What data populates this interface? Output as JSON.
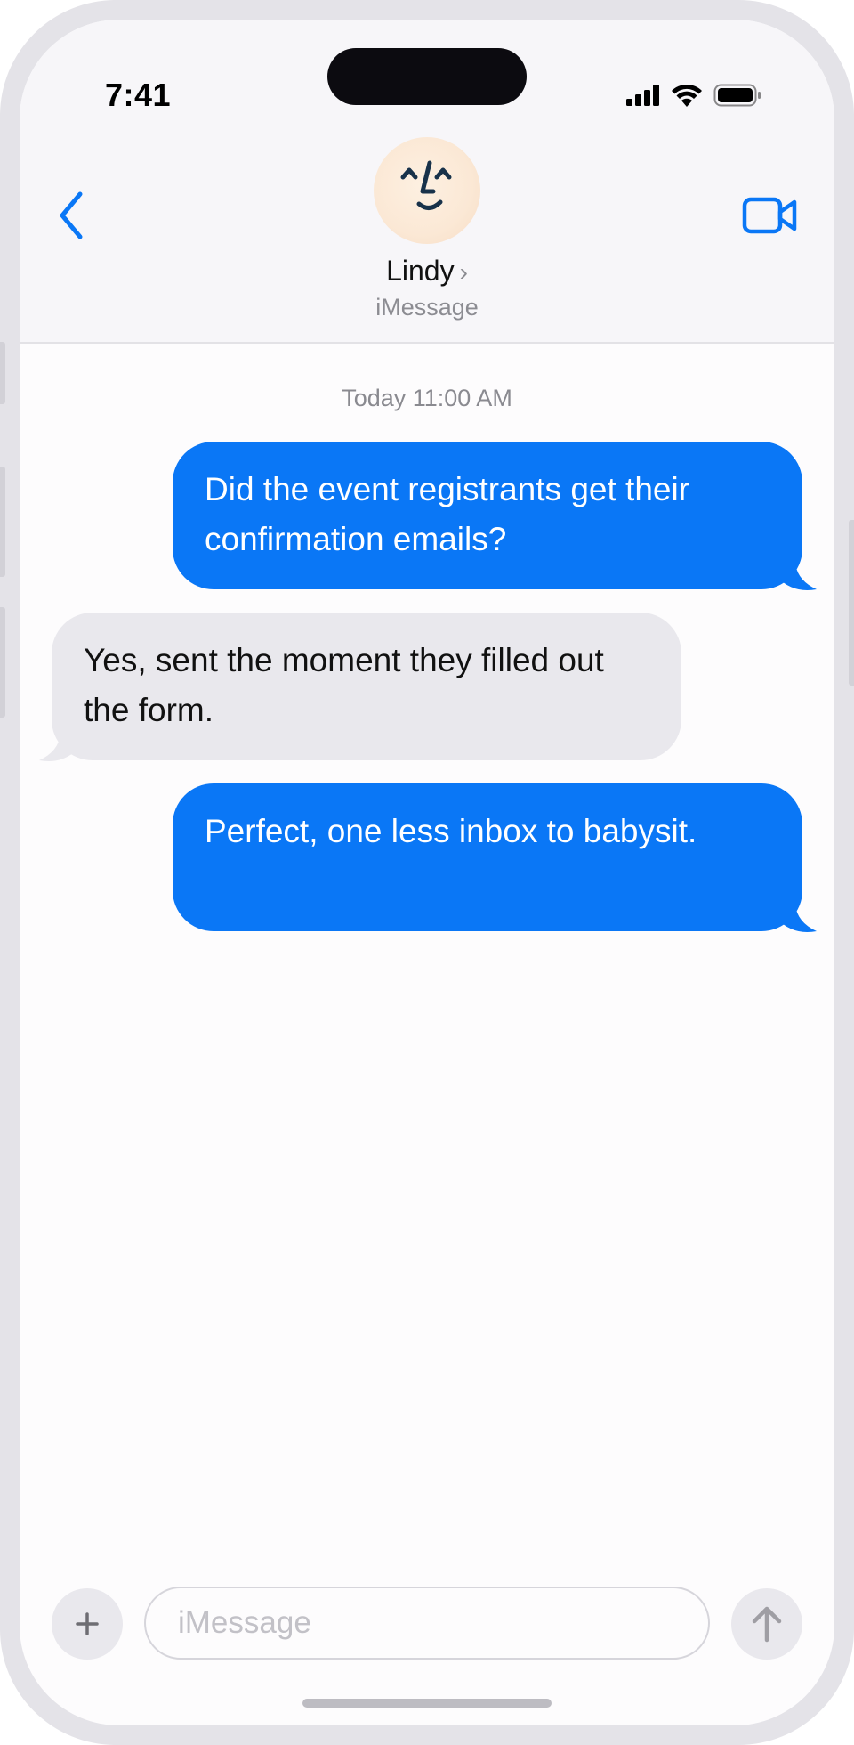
{
  "status_bar": {
    "time": "7:41",
    "icons": [
      "signal-icon",
      "wifi-icon",
      "battery-icon"
    ]
  },
  "header": {
    "back_icon": "chevron-left-icon",
    "contact_name": "Lindy",
    "contact_chevron": "›",
    "subtitle": "iMessage",
    "video_icon": "video-camera-icon",
    "avatar_icon": "face-avatar"
  },
  "conversation": {
    "timestamp": "Today 11:00 AM",
    "messages": [
      {
        "direction": "outgoing",
        "text": "Did the event registrants get their confirmation emails?"
      },
      {
        "direction": "incoming",
        "text": "Yes, sent the moment they filled out the form."
      },
      {
        "direction": "outgoing",
        "text": "Perfect, one less inbox to babysit."
      }
    ]
  },
  "composer": {
    "plus_icon": "plus-icon",
    "placeholder": "iMessage",
    "value": "",
    "send_icon": "arrow-up-icon"
  },
  "colors": {
    "accent": "#0a77f6",
    "incoming_bubble": "#e9e8ed",
    "header_bg": "#f7f6f9"
  }
}
